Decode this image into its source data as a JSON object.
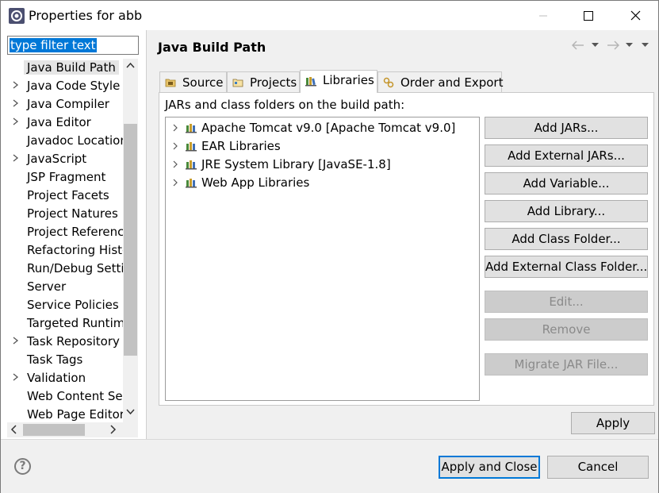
{
  "window": {
    "title": "Properties for abb"
  },
  "filter": {
    "value": "type filter text"
  },
  "tree": {
    "items": [
      {
        "label": "Java Build Path",
        "expandable": false,
        "selected": true
      },
      {
        "label": "Java Code Style",
        "expandable": true
      },
      {
        "label": "Java Compiler",
        "expandable": true
      },
      {
        "label": "Java Editor",
        "expandable": true
      },
      {
        "label": "Javadoc Location",
        "expandable": false
      },
      {
        "label": "JavaScript",
        "expandable": true
      },
      {
        "label": "JSP Fragment",
        "expandable": false
      },
      {
        "label": "Project Facets",
        "expandable": false
      },
      {
        "label": "Project Natures",
        "expandable": false
      },
      {
        "label": "Project References",
        "expandable": false
      },
      {
        "label": "Refactoring History",
        "expandable": false
      },
      {
        "label": "Run/Debug Settings",
        "expandable": false
      },
      {
        "label": "Server",
        "expandable": false
      },
      {
        "label": "Service Policies",
        "expandable": false
      },
      {
        "label": "Targeted Runtimes",
        "expandable": false
      },
      {
        "label": "Task Repository",
        "expandable": true
      },
      {
        "label": "Task Tags",
        "expandable": false
      },
      {
        "label": "Validation",
        "expandable": true
      },
      {
        "label": "Web Content Settings",
        "expandable": false
      },
      {
        "label": "Web Page Editor",
        "expandable": false
      }
    ]
  },
  "page": {
    "title": "Java Build Path"
  },
  "tabs": [
    {
      "label": "Source",
      "icon": "source-folder-icon"
    },
    {
      "label": "Projects",
      "icon": "projects-icon"
    },
    {
      "label": "Libraries",
      "icon": "libraries-icon",
      "active": true
    },
    {
      "label": "Order and Export",
      "icon": "order-export-icon"
    }
  ],
  "libraries": {
    "heading": "JARs and class folders on the build path:",
    "items": [
      {
        "label": "Apache Tomcat v9.0 [Apache Tomcat v9.0]"
      },
      {
        "label": "EAR Libraries"
      },
      {
        "label": "JRE System Library [JavaSE-1.8]"
      },
      {
        "label": "Web App Libraries"
      }
    ]
  },
  "buttons": {
    "add_jars": "Add JARs...",
    "add_external_jars": "Add External JARs...",
    "add_variable": "Add Variable...",
    "add_library": "Add Library...",
    "add_class_folder": "Add Class Folder...",
    "add_external_class_folder": "Add External Class Folder...",
    "edit": "Edit...",
    "remove": "Remove",
    "migrate_jar": "Migrate JAR File...",
    "apply": "Apply",
    "apply_and_close": "Apply and Close",
    "cancel": "Cancel"
  },
  "footer": {
    "help": "?"
  },
  "colors": {
    "accent": "#0078d7",
    "selection": "#e5e5e5"
  }
}
